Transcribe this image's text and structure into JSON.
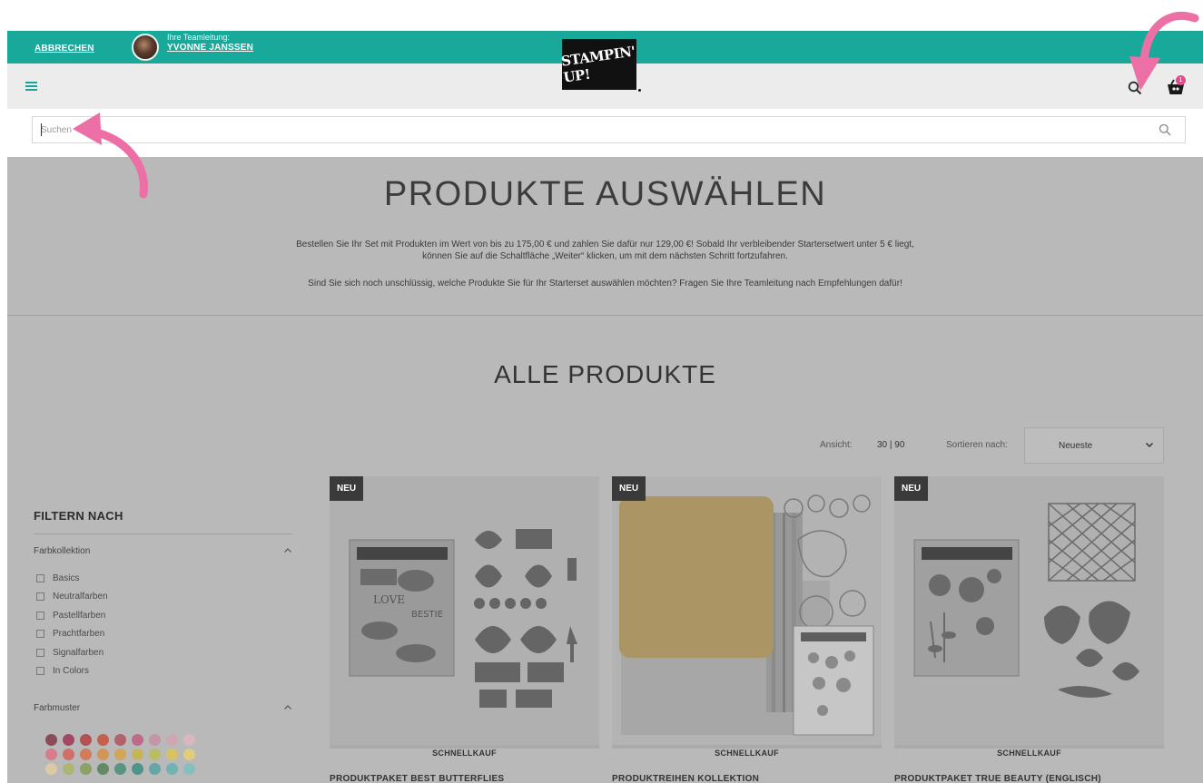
{
  "header": {
    "cancel_label": "ABBRECHEN",
    "team_lead_label": "Ihre Teamleitung:",
    "team_lead_name": "YVONNE JANSSEN",
    "logo_text": "STAMPIN' UP!",
    "cart_count": "1",
    "accent_color": "#18a99a"
  },
  "search": {
    "placeholder": "Suchen",
    "value": ""
  },
  "hero": {
    "title": "PRODUKTE AUSWÄHLEN",
    "paragraph1_line1": "Bestellen Sie Ihr Set mit Produkten im Wert von bis zu 175,00 € und zahlen Sie dafür nur 129,00 €! Sobald Ihr verbleibender Startersetwert unter 5 € liegt,",
    "paragraph1_line2": "können Sie auf die Schaltfläche „Weiter“ klicken, um mit dem nächsten Schritt fortzufahren.",
    "paragraph2": "Sind Sie sich noch unschlüssig, welche Produkte Sie für Ihr Starterset auswählen möchten? Fragen Sie Ihre Teamleitung nach Empfehlungen dafür!"
  },
  "products_section": {
    "title": "ALLE PRODUKTE",
    "view_label": "Ansicht:",
    "view_options": "30 | 90",
    "sort_label": "Sortieren nach:",
    "sort_value": "Neueste"
  },
  "filters": {
    "title": "FILTERN NACH",
    "groups": [
      {
        "label": "Farbkollektion",
        "items": [
          "Basics",
          "Neutralfarben",
          "Pastellfarben",
          "Prachtfarben",
          "Signalfarben",
          "In Colors"
        ]
      },
      {
        "label": "Farbmuster"
      }
    ],
    "swatch_colors": [
      [
        "#7a2a3a",
        "#a0204a",
        "#b03030",
        "#c8432a",
        "#b0474f",
        "#c0507a",
        "#c78aa0",
        "#d7a0b0",
        "#e3b7c1"
      ],
      [
        "#e06a7a",
        "#d8564e",
        "#d8683a",
        "#dd8a3a",
        "#d8a23a",
        "#c8b43a",
        "#b9c04a",
        "#e2c64a",
        "#ecd36a"
      ],
      [
        "#e8d0a0",
        "#a8b45a",
        "#7e9a4a",
        "#4a7a4a",
        "#3a8a6a",
        "#2a8a7a",
        "#4aa0a0",
        "#5ab0b0",
        "#7ac0c0"
      ]
    ]
  },
  "products": [
    {
      "badge": "NEU",
      "quick_label": "SCHNELLKAUF",
      "name": "PRODUKTPAKET BEST BUTTERFLIES"
    },
    {
      "badge": "NEU",
      "quick_label": "SCHNELLKAUF",
      "name": "PRODUKTREIHEN KOLLEKTION"
    },
    {
      "badge": "NEU",
      "quick_label": "SCHNELLKAUF",
      "name": "PRODUKTPAKET TRUE BEAUTY (ENGLISCH)"
    }
  ],
  "annotation_color": "#ec6fa6"
}
